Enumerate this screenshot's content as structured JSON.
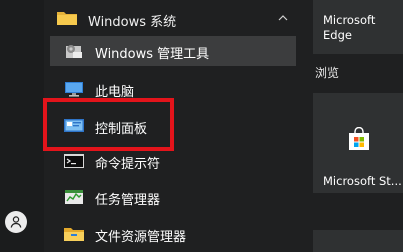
{
  "start_menu": {
    "group": {
      "label": "Windows 系统",
      "icon": "folder-icon"
    },
    "items": [
      {
        "label": "Windows 管理工具",
        "icon": "admin-tools-icon"
      },
      {
        "label": "此电脑",
        "icon": "this-pc-icon"
      },
      {
        "label": "控制面板",
        "icon": "control-panel-icon"
      },
      {
        "label": "命令提示符",
        "icon": "command-prompt-icon"
      },
      {
        "label": "任务管理器",
        "icon": "task-manager-icon"
      },
      {
        "label": "文件资源管理器",
        "icon": "file-explorer-icon"
      }
    ],
    "highlight_color": "#e3141b"
  },
  "tiles": {
    "edge": {
      "line1": "Microsoft",
      "line2": "Edge"
    },
    "section_title": "浏览",
    "store": {
      "label": "Microsoft St..."
    }
  }
}
